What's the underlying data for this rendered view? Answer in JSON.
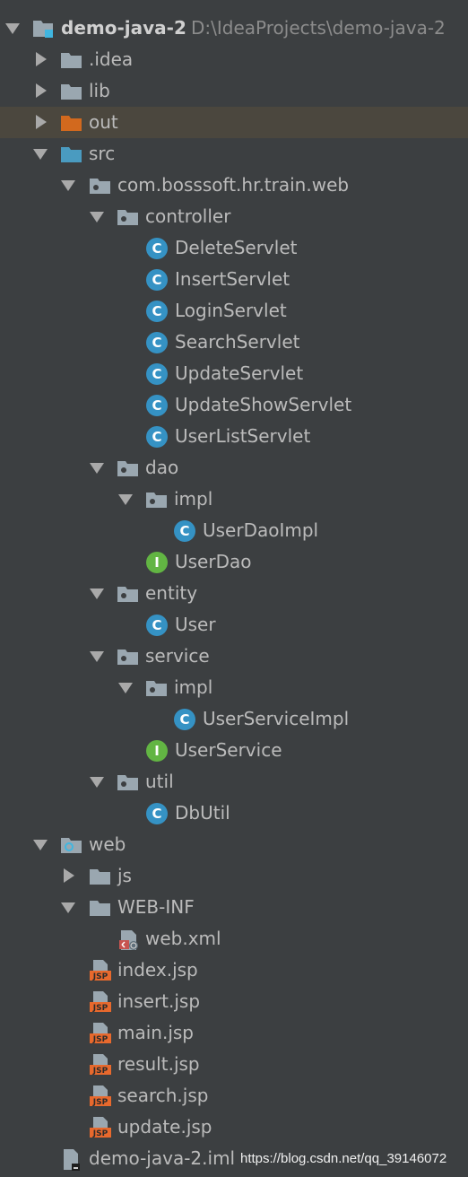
{
  "project": {
    "name": "demo-java-2",
    "path": "D:\\IdeaProjects\\demo-java-2"
  },
  "nodes": {
    "idea": ".idea",
    "lib": "lib",
    "out": "out",
    "src": "src",
    "pkg": "com.bosssoft.hr.train.web",
    "controller": "controller",
    "c1": "DeleteServlet",
    "c2": "InsertServlet",
    "c3": "LoginServlet",
    "c4": "SearchServlet",
    "c5": "UpdateServlet",
    "c6": "UpdateShowServlet",
    "c7": "UserListServlet",
    "dao": "dao",
    "dao_impl": "impl",
    "userdaoimpl": "UserDaoImpl",
    "userdao": "UserDao",
    "entity": "entity",
    "user": "User",
    "service": "service",
    "service_impl": "impl",
    "userserviceimpl": "UserServiceImpl",
    "userservice": "UserService",
    "util": "util",
    "dbutil": "DbUtil",
    "web": "web",
    "js": "js",
    "webinf": "WEB-INF",
    "webxml": "web.xml",
    "jsp1": "index.jsp",
    "jsp2": "insert.jsp",
    "jsp3": "main.jsp",
    "jsp4": "result.jsp",
    "jsp5": "search.jsp",
    "jsp6": "update.jsp",
    "iml": "demo-java-2.iml"
  },
  "icon_letters": {
    "class": "C",
    "interface": "I",
    "jsp": "JSP"
  },
  "watermark": "https://blog.csdn.net/qq_39146072",
  "colors": {
    "background": "#3c3f41",
    "selected_row": "#4b473e",
    "folder": "#9aa7b0",
    "source_folder": "#4a9bc0",
    "excluded_folder": "#d2691e",
    "class_badge": "#3592c4",
    "interface_badge": "#62b543",
    "jsp": "#e8692d"
  }
}
